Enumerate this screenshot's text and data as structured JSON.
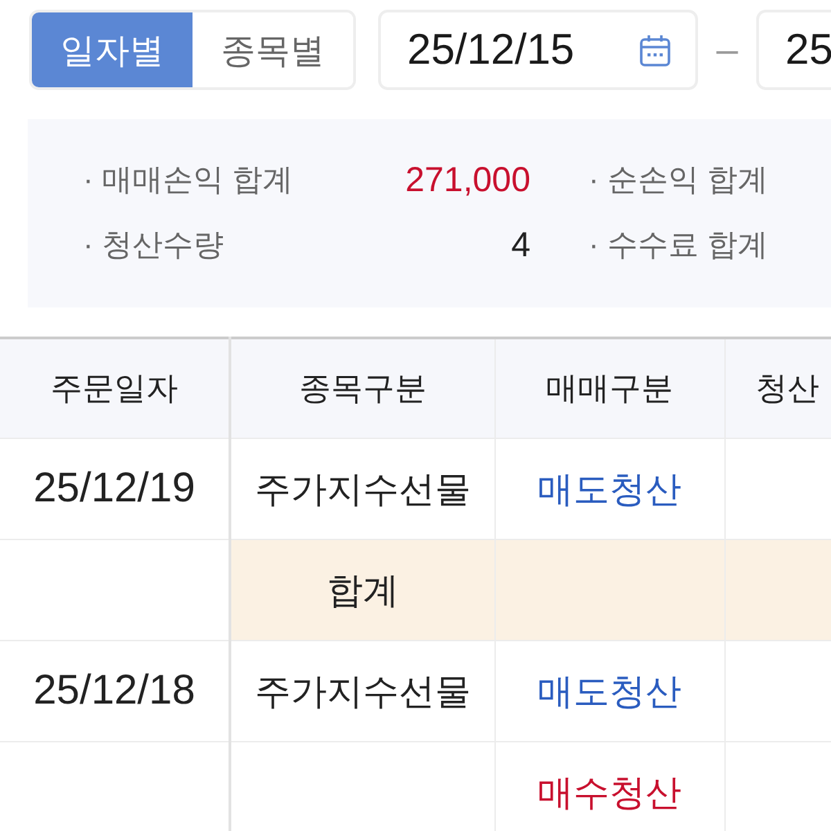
{
  "view_tabs": [
    {
      "label": "일자별",
      "selected": true
    },
    {
      "label": "종목별",
      "selected": false
    }
  ],
  "date_range": {
    "from": "25/12/15",
    "separator": "–",
    "to": "25"
  },
  "summary": {
    "items": [
      {
        "label": "· 매매손익 합계",
        "value": "271,000",
        "kind": "profit"
      },
      {
        "label": "· 순손익 합계"
      },
      {
        "label": "· 청산수량",
        "value": "4",
        "kind": "count"
      },
      {
        "label": "· 수수료 합계"
      }
    ]
  },
  "table": {
    "columns": [
      "주문일자",
      "종목구분",
      "매매구분",
      "청산"
    ],
    "rows": [
      {
        "kind": "detail",
        "date": "25/12/19",
        "product": "주가지수선물",
        "trade": {
          "text": "매도청산",
          "kind": "sell"
        }
      },
      {
        "kind": "subtotal",
        "label": "합계"
      },
      {
        "kind": "detail",
        "date": "25/12/18",
        "product": "주가지수선물",
        "trade": {
          "text": "매도청산",
          "kind": "sell"
        }
      },
      {
        "kind": "detail",
        "trade": {
          "text": "매수청산",
          "kind": "buy"
        }
      }
    ]
  }
}
